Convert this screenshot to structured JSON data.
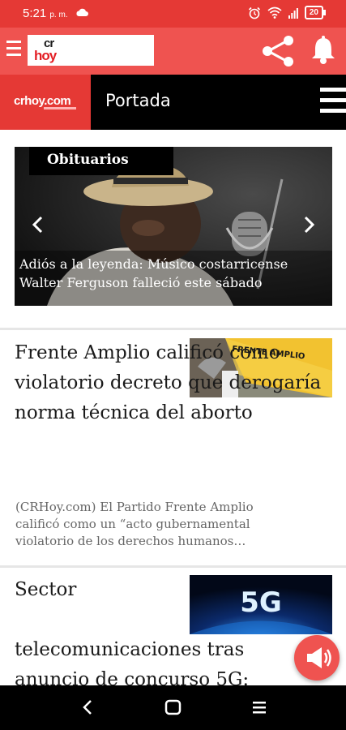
{
  "status_bar": {
    "time": "5:21",
    "ampm": "p. m.",
    "battery": "20",
    "cloud_icon": "cloud-icon",
    "alarm_icon": "alarm-icon",
    "wifi_icon": "wifi-icon"
  },
  "app_bar": {
    "logo_line1": "cr",
    "logo_line2": "hoy",
    "share_icon": "share-icon",
    "bell_icon": "bell-icon",
    "menu_icon": "menu-icon",
    "accent_color": "#ef5350"
  },
  "section": {
    "logo": "crhoy.com",
    "title": "Portada",
    "menu_icon": "hamburger-icon"
  },
  "featured": {
    "tag": "Obituarios",
    "caption": "Adiós a la leyenda: Músico costarricense Walter Ferguson falleció este sábado"
  },
  "articles": [
    {
      "title": "Frente Amplio calificó como violatorio decreto que derogaría norma técnica del aborto",
      "summary": "(CRHoy.com) El Partido Frente Amplio calificó como un “acto gubernamental violatorio de los derechos humanos…",
      "thumb_text": "FRENTE AMPLIO"
    },
    {
      "title": "Sector",
      "title_cont": "telecomunicaciones tras anuncio de concurso 5G:",
      "thumb_text": "5G"
    }
  ],
  "fab": {
    "icon": "megaphone-icon"
  },
  "nav": {
    "back_icon": "back-icon",
    "home_icon": "home-icon",
    "recents_icon": "recents-icon"
  }
}
